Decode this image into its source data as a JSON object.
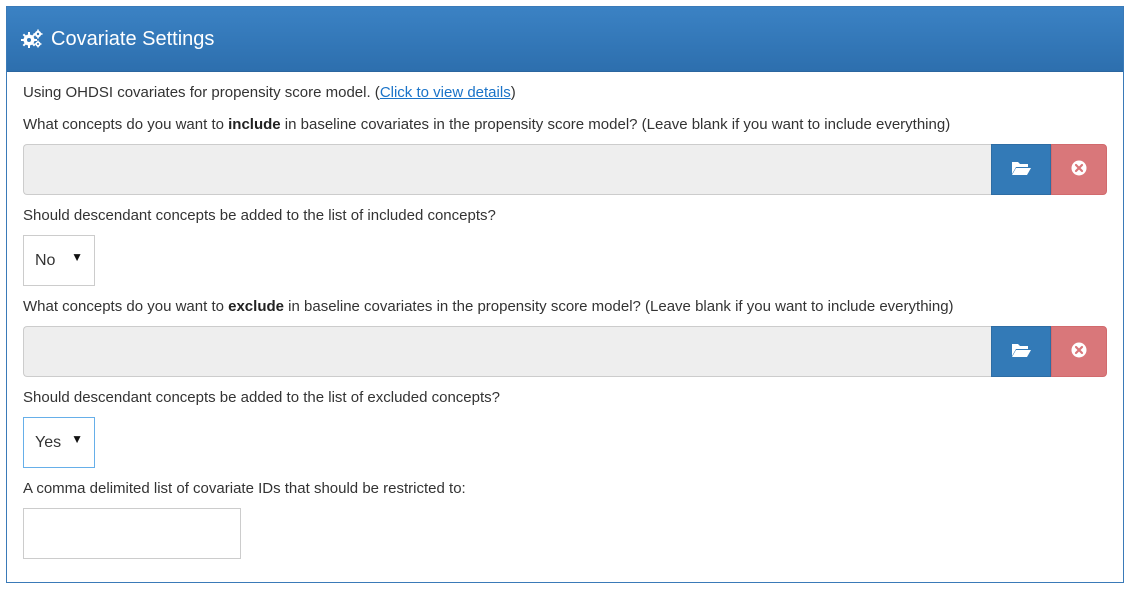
{
  "panel": {
    "title": "Covariate Settings",
    "icon": "gears-icon"
  },
  "intro": {
    "text": "Using OHDSI covariates for propensity score model. (",
    "link": "Click to view details",
    "close": ")"
  },
  "include": {
    "question_pre": "What concepts do you want to ",
    "question_bold": "include",
    "question_post": " in baseline covariates in the propensity score model? (Leave blank if you want to include everything)",
    "value": "",
    "open_icon": "folder-open-icon",
    "clear_icon": "remove-circle-icon"
  },
  "include_descendants": {
    "question": "Should descendant concepts be added to the list of included concepts?",
    "selected": "No",
    "arrow": "▼"
  },
  "exclude": {
    "question_pre": "What concepts do you want to ",
    "question_bold": "exclude",
    "question_post": " in baseline covariates in the propensity score model? (Leave blank if you want to include everything)",
    "value": "",
    "open_icon": "folder-open-icon",
    "clear_icon": "remove-circle-icon"
  },
  "exclude_descendants": {
    "question": "Should descendant concepts be added to the list of excluded concepts?",
    "selected": "Yes",
    "arrow": "▼"
  },
  "restrict": {
    "label": "A comma delimited list of covariate IDs that should be restricted to:",
    "value": ""
  },
  "colors": {
    "heading": "#337ab7",
    "open_button": "#337ab7",
    "clear_button": "#d9777a"
  }
}
